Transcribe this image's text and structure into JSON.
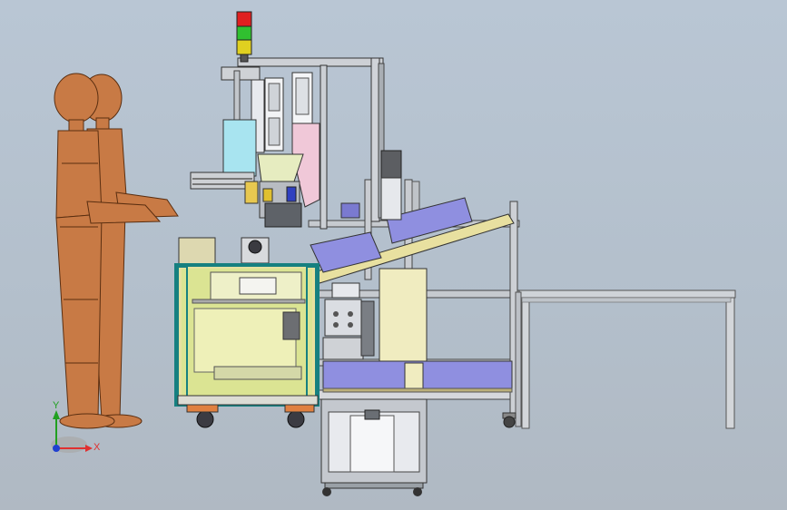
{
  "viewport": {
    "background_top": "#b9c6d4",
    "background_bottom": "#b0b9c3"
  },
  "triad": {
    "x_label": "X",
    "y_label": "Y",
    "z_label": "",
    "x_color": "#e03030",
    "y_color": "#20a020",
    "z_color": "#2040d0"
  },
  "tower_light": {
    "colors": [
      "#e02020",
      "#30c030",
      "#e0d020"
    ]
  },
  "colors": {
    "mannequin": "#c87a45",
    "mannequin_dark": "#8a4a22",
    "frame": "#c8ccd2",
    "frame_dark": "#6e7278",
    "cabinet_glass": "#d8e490",
    "cabinet_frame": "#1a8080",
    "cyan_box": "#a8e4f0",
    "pink_panel": "#f0c8d8",
    "blue_tray": "#8f8fe0",
    "cream": "#f0ecc0"
  }
}
